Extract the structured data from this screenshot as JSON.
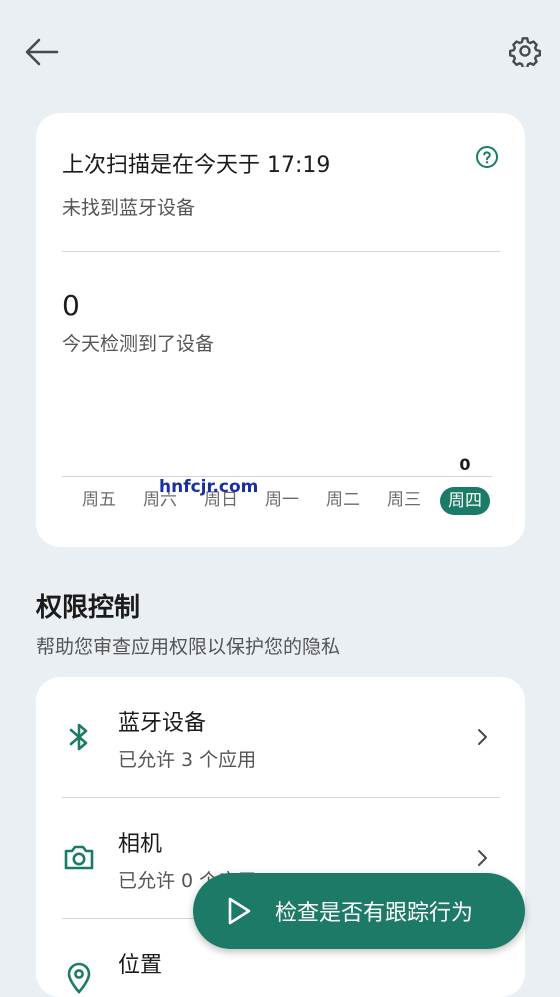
{
  "header": {
    "back_icon": "arrow-left-icon",
    "settings_icon": "gear-icon"
  },
  "scan_card": {
    "title": "上次扫描是在今天于 17:19",
    "subtitle": "未找到蓝牙设备",
    "help_icon": "question-circle-icon",
    "count": "0",
    "count_label": "今天检测到了设备",
    "watermark": "hnfcjr.com",
    "chart_data": {
      "type": "bar",
      "categories": [
        "周五",
        "周六",
        "周日",
        "周一",
        "周二",
        "周三",
        "周四"
      ],
      "values": [
        null,
        null,
        null,
        null,
        null,
        null,
        0
      ],
      "value_labels": [
        "",
        "",
        "",
        "",
        "",
        "",
        "0"
      ],
      "highlight": "周四"
    }
  },
  "permissions": {
    "title": "权限控制",
    "subtitle": "帮助您审查应用权限以保护您的隐私",
    "items": [
      {
        "name": "蓝牙设备",
        "desc": "已允许 3 个应用",
        "icon": "bluetooth-icon"
      },
      {
        "name": "相机",
        "desc": "已允许 0 个应用",
        "icon": "camera-icon"
      },
      {
        "name": "位置",
        "desc": "",
        "icon": "location-icon"
      }
    ]
  },
  "fab": {
    "label": "检查是否有跟踪行为",
    "icon": "play-icon"
  },
  "colors": {
    "accent": "#1a7b66",
    "background": "#eaeff4",
    "card": "#ffffff"
  }
}
